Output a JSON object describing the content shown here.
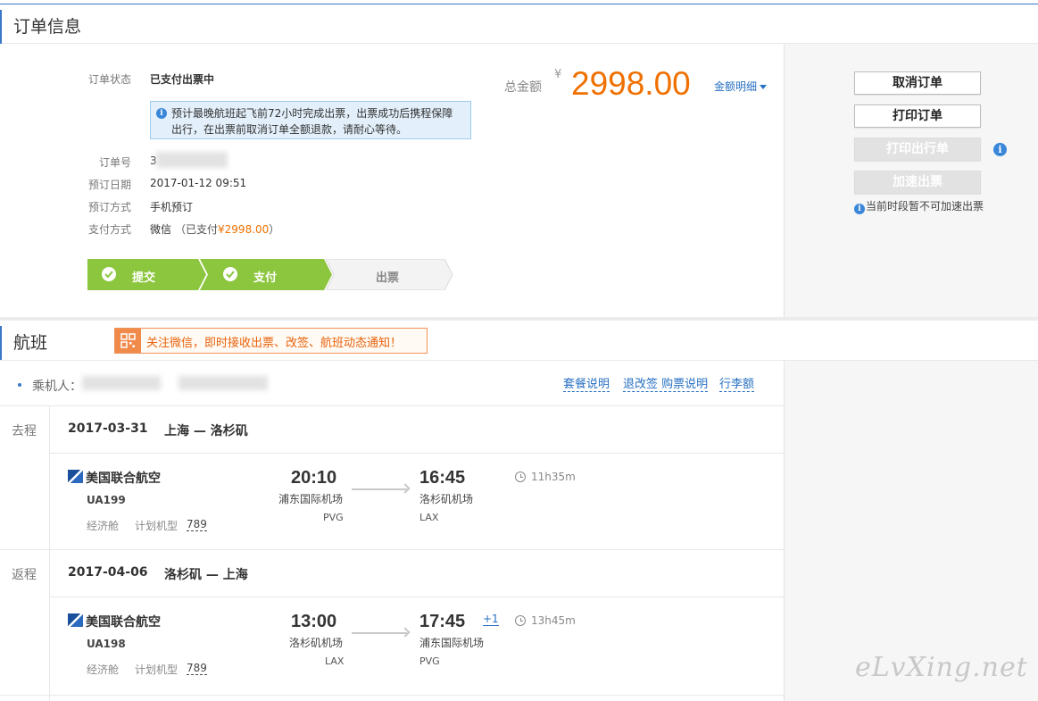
{
  "order": {
    "section_title": "订单信息",
    "status_label": "订单状态",
    "status_value": "已支付出票中",
    "notice": "预计最晚航班起飞前72小时完成出票，出票成功后携程保障出行，在出票前取消订单全额退款，请耐心等待。",
    "order_no_label": "订单号",
    "order_no_value": "3",
    "booking_date_label": "预订日期",
    "booking_date_value": "2017-01-12 09:51",
    "booking_method_label": "预订方式",
    "booking_method_value": "手机预订",
    "payment_label": "支付方式",
    "payment_value": "微信",
    "payment_paid_prefix": "（已支付",
    "payment_paid_amount": "¥2998.00",
    "payment_paid_suffix": "）",
    "steps": [
      {
        "label": "提交",
        "done": true
      },
      {
        "label": "支付",
        "done": true
      },
      {
        "label": "出票",
        "done": false
      }
    ],
    "total_label": "总金额",
    "currency": "¥",
    "total_value": "2998.00",
    "detail_link": "金额明细"
  },
  "actions": {
    "cancel": "取消订单",
    "print_order": "打印订单",
    "print_itinerary": "打印出行单",
    "expedite": "加速出票",
    "expedite_hint": "当前时段暂不可加速出票"
  },
  "flight": {
    "section_title": "航班",
    "wechat_banner": "关注微信，即时接收出票、改签、航班动态通知！",
    "passenger_label": "乘机人：",
    "links": [
      "套餐说明",
      "退改签 购票说明",
      "行李额"
    ],
    "segments": [
      {
        "type": "去程",
        "date": "2017-03-31",
        "route": "上海 — 洛杉矶",
        "airline": "美国联合航空",
        "flight_no": "UA199",
        "cabin": "经济舱",
        "plane_type_label": "计划机型",
        "plane_type": "789",
        "dep_time": "20:10",
        "dep_airport": "浦东国际机场",
        "dep_code": "PVG",
        "arr_time": "16:45",
        "arr_airport": "洛杉矶机场",
        "arr_code": "LAX",
        "duration": "11h35m",
        "plus_day": ""
      },
      {
        "type": "返程",
        "date": "2017-04-06",
        "route": "洛杉矶 — 上海",
        "airline": "美国联合航空",
        "flight_no": "UA198",
        "cabin": "经济舱",
        "plane_type_label": "计划机型",
        "plane_type": "789",
        "dep_time": "13:00",
        "dep_airport": "洛杉矶机场",
        "dep_code": "LAX",
        "arr_time": "17:45",
        "arr_airport": "浦东国际机场",
        "arr_code": "PVG",
        "duration": "13h45m",
        "plus_day": "+1"
      }
    ]
  },
  "watermark": "eLvXing.net",
  "colors": {
    "accent": "#3a78c7",
    "price": "#f07000",
    "step_done": "#8cc63e",
    "link": "#2770c2"
  }
}
